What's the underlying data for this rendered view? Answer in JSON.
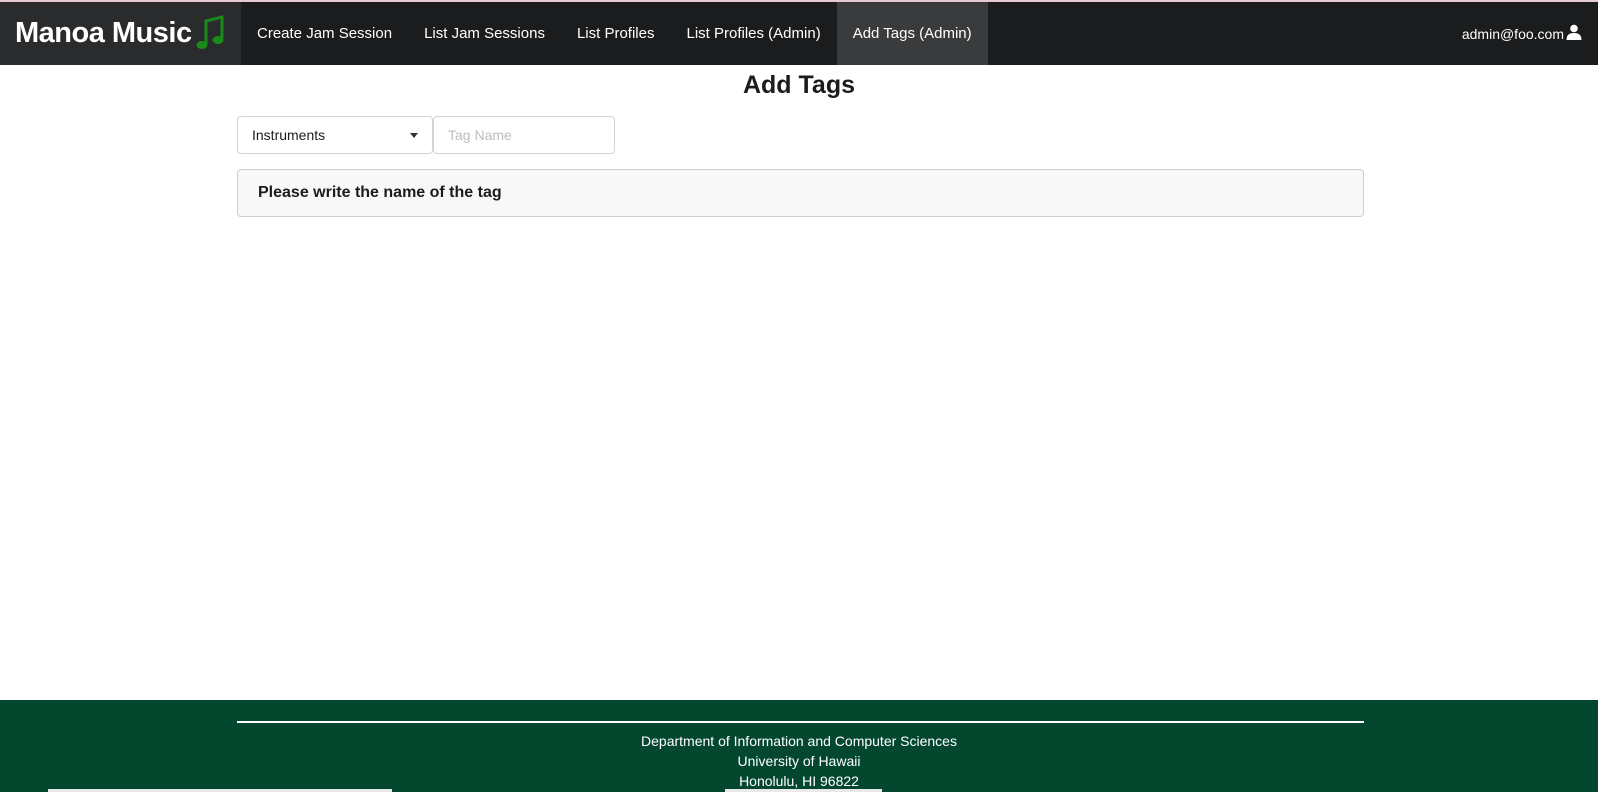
{
  "navbar": {
    "brand": "Manoa Music",
    "brand_icon": "music-note-icon",
    "items": [
      {
        "label": "Create Jam Session",
        "active": false
      },
      {
        "label": "List Jam Sessions",
        "active": false
      },
      {
        "label": "List Profiles",
        "active": false
      },
      {
        "label": "List Profiles (Admin)",
        "active": false
      },
      {
        "label": "Add Tags (Admin)",
        "active": true
      }
    ],
    "user": "admin@foo.com",
    "user_icon": "user-icon"
  },
  "page": {
    "title": "Add Tags"
  },
  "form": {
    "category_selected": "Instruments",
    "tag_placeholder": "Tag Name",
    "message": "Please write the name of the tag"
  },
  "footer": {
    "line1": "Department of Information and Computer Sciences",
    "line2": "University of Hawaii",
    "line3": "Honolulu, HI 96822"
  },
  "colors": {
    "navbar": "#1b1c1d",
    "footer": "#03472e",
    "note": "#1a8a1a"
  }
}
